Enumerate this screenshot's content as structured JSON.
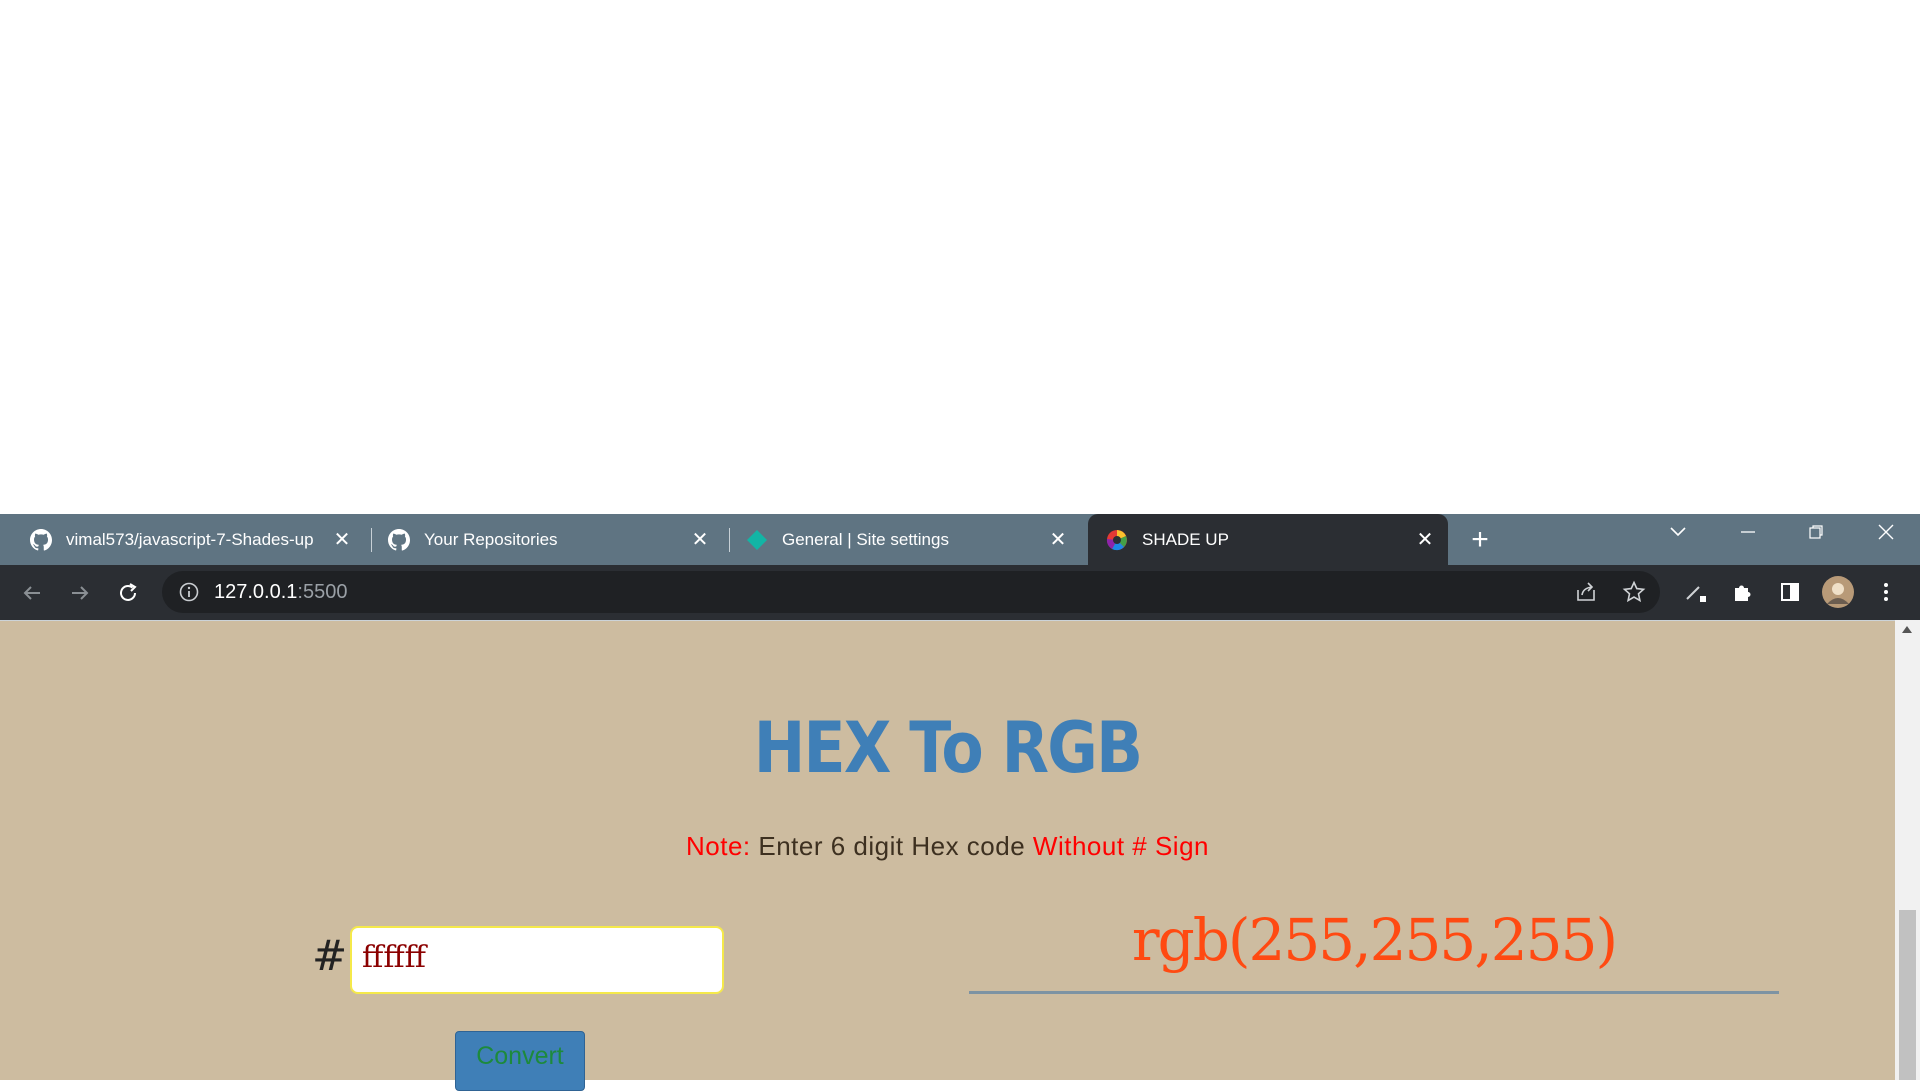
{
  "browser": {
    "tabs": [
      {
        "title": "vimal573/javascript-7-Shades-up",
        "icon": "github-icon",
        "active": false
      },
      {
        "title": "Your Repositories",
        "icon": "github-icon",
        "active": false
      },
      {
        "title": "General | Site settings",
        "icon": "site-settings-icon",
        "active": false
      },
      {
        "title": "SHADE UP",
        "icon": "color-wheel-icon",
        "active": true
      }
    ],
    "address": {
      "host": "127.0.0.1",
      "port": ":5500"
    }
  },
  "page": {
    "heading": "HEX To RGB",
    "note": {
      "label": "Note:",
      "text": " Enter 6 digit Hex code ",
      "emphasis": "Without # Sign"
    },
    "hash_symbol": "#",
    "hex_input_value": "ffffff",
    "convert_label": "Convert",
    "result": "rgb(255,255,255)"
  },
  "colors": {
    "page_background": "#cdbca0",
    "heading": "#3f7fb7",
    "note_red": "#ff0000",
    "result": "#ff4a12",
    "button": "#3f7fb7",
    "button_text": "#1d8a3c",
    "input_text": "#8b0000"
  }
}
